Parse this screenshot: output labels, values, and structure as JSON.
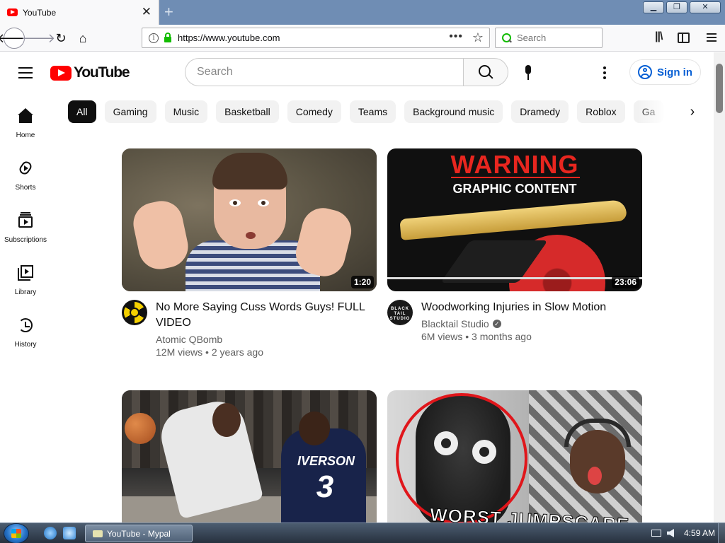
{
  "browser": {
    "tab_title": "YouTube",
    "new_tab": "+",
    "close_tab": "✕",
    "window_controls": {
      "minimize": "▁",
      "maximize": "❐",
      "close": "✕"
    },
    "url": "https://www.youtube.com",
    "search_placeholder": "Search"
  },
  "youtube": {
    "logo_text": "YouTube",
    "search_placeholder": "Search",
    "sign_in": "Sign in",
    "chips": [
      "All",
      "Gaming",
      "Music",
      "Basketball",
      "Comedy",
      "Teams",
      "Background music",
      "Dramedy",
      "Roblox",
      "Ga"
    ],
    "guide": [
      {
        "label": "Home",
        "icon": "home-icon"
      },
      {
        "label": "Shorts",
        "icon": "shorts-icon"
      },
      {
        "label": "Subscriptions",
        "icon": "subscriptions-icon"
      },
      {
        "label": "Library",
        "icon": "library-icon"
      },
      {
        "label": "History",
        "icon": "history-icon"
      }
    ],
    "videos": [
      {
        "title": "No More Saying Cuss Words Guys! FULL VIDEO",
        "channel": "Atomic QBomb",
        "views": "12M views",
        "age": "2 years ago",
        "duration": "1:20",
        "verified": false
      },
      {
        "title": "Woodworking Injuries in Slow Motion",
        "channel": "Blacktail Studio",
        "views": "6M views",
        "age": "3 months ago",
        "duration": "23:06",
        "verified": true,
        "thumb_text": {
          "warning": "WARNING",
          "graphic": "GRAPHIC CONTENT"
        },
        "avatar_text": "BLACK TAIL STUDIO"
      },
      {
        "thumb_text": {
          "jersey": "IVERSON",
          "number": "3"
        }
      },
      {
        "thumb_text": {
          "caption": "WORST JUMPSCARE"
        }
      }
    ],
    "separator": "•"
  },
  "taskbar": {
    "task_title": "YouTube - Mypal",
    "clock": "4:59 AM"
  },
  "colors": {
    "youtube_red": "#ff0000",
    "link_blue": "#065fd4",
    "chip_bg": "#f2f2f2",
    "chip_active_bg": "#0f0f0f",
    "secure_green": "#12bc00"
  }
}
